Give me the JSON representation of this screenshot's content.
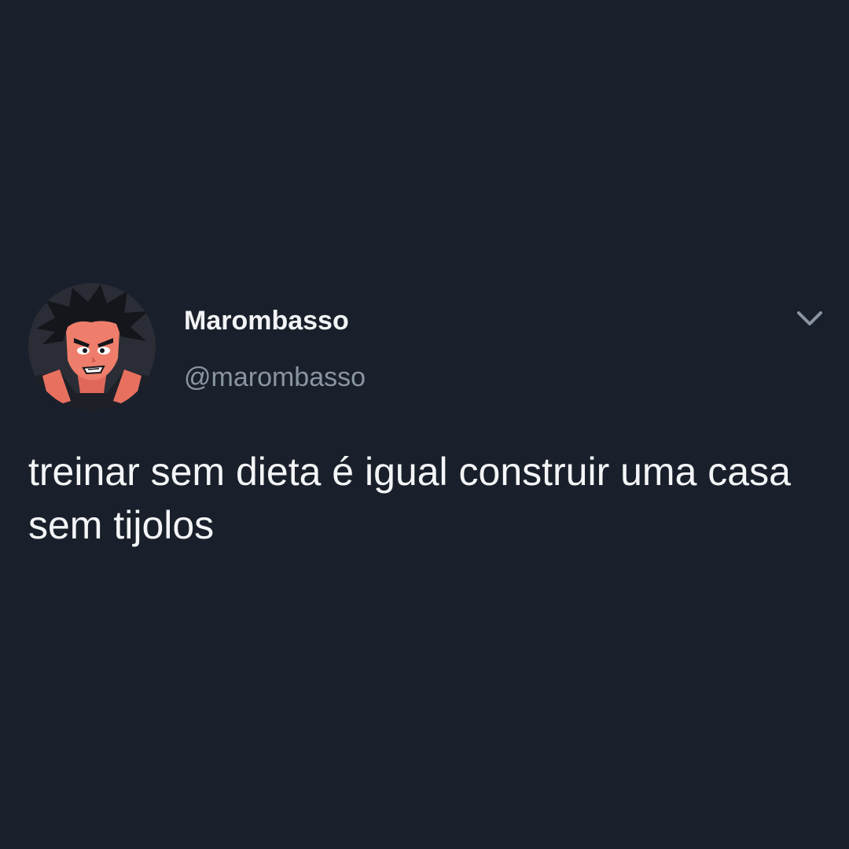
{
  "tweet": {
    "author": {
      "display_name": "Marombasso",
      "handle": "@marombasso",
      "avatar_icon": "anime-character-avatar-icon"
    },
    "menu_icon": "chevron-down-icon",
    "text": "treinar sem dieta é igual construir uma casa sem tijolos"
  },
  "colors": {
    "background": "#1a202b",
    "display_name": "#f2f3f5",
    "handle": "#8a95a3",
    "text": "#f4f5f7",
    "chevron": "#8a95a3"
  }
}
